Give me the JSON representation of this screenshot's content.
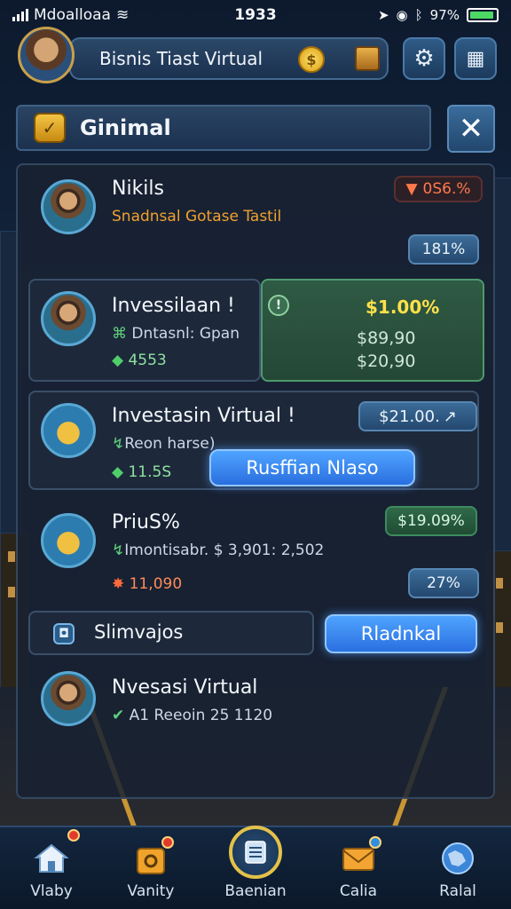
{
  "status_bar": {
    "carrier": "Mdoalloaa",
    "time": "1933",
    "battery": "97%"
  },
  "top_bar": {
    "title": "Bisnis Tiast Virtual",
    "coin_symbol": "$"
  },
  "header": {
    "title": "Ginimal"
  },
  "rows": [
    {
      "title": "Nikils",
      "subtitle": "Snadnsal Gotase Tastil",
      "change": "0S6.%",
      "badge": "181%"
    },
    {
      "title": "Invessilaan",
      "title_mark": "!",
      "subtitle": "Dntasnl: Gpan",
      "value": "4553",
      "card_title": "$1.00%",
      "card_value1": "$89,90",
      "card_value2": "$20,90"
    },
    {
      "title": "Investasin Virtual",
      "title_mark": "!",
      "subtitle": "Reon harse)",
      "value": "11.5S",
      "price": "$21.00.",
      "action": "Rusffian Nlaso"
    },
    {
      "title": "PriuS%",
      "subtitle": "Imontisabr. $ 3,901: 2,502",
      "value": "11,090",
      "change": "$19.09%",
      "badge": "27%"
    },
    {
      "title": "Slimvajos",
      "action": "Rladnkal"
    },
    {
      "title": "Nvesasi Virtual",
      "subtitle": "A1 Reeoin 25 1120"
    }
  ],
  "bottom_nav": [
    {
      "label": "Vlaby",
      "icon": "home-icon"
    },
    {
      "label": "Vanity",
      "icon": "bag-icon"
    },
    {
      "label": "Baenian",
      "icon": "document-icon"
    },
    {
      "label": "Calia",
      "icon": "mail-icon"
    },
    {
      "label": "Ralal",
      "icon": "globe-icon"
    }
  ],
  "colors": {
    "accent_blue": "#2a6fe0",
    "green": "#4e9a6c",
    "gold": "#e3c24a",
    "loss": "#ff7a4a"
  }
}
